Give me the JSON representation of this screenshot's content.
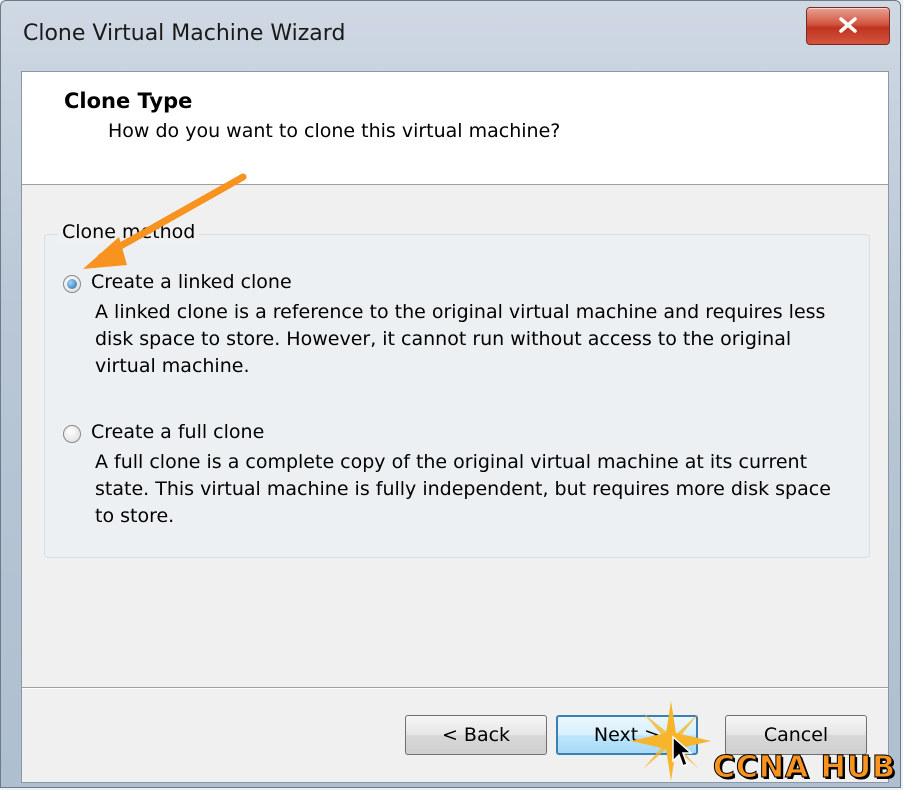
{
  "window": {
    "title": "Clone Virtual Machine Wizard"
  },
  "header": {
    "title": "Clone Type",
    "subtitle": "How do you want to clone this virtual machine?"
  },
  "group": {
    "legend": "Clone method",
    "options": [
      {
        "label": "Create a linked clone",
        "selected": true,
        "desc_lines": [
          "A linked clone is a reference to the original virtual machine and requires less",
          "disk space to store. However, it cannot run without access to the original",
          "virtual machine."
        ]
      },
      {
        "label": "Create a full clone",
        "selected": false,
        "desc_lines": [
          "A full clone is a complete copy of the original virtual machine at its current",
          "state. This virtual machine is fully independent, but requires more disk space",
          "to store."
        ]
      }
    ]
  },
  "buttons": {
    "back": "< Back",
    "next": "Next >",
    "cancel": "Cancel"
  },
  "watermark": "CCNA HUB",
  "colors": {
    "accent_arrow": "#f7931e",
    "close_button": "#c0331e",
    "default_button_border": "#3c7fb1"
  },
  "icons": [
    "close-icon",
    "annotation-arrow-icon",
    "mouse-cursor-icon",
    "sparkle-icon"
  ]
}
